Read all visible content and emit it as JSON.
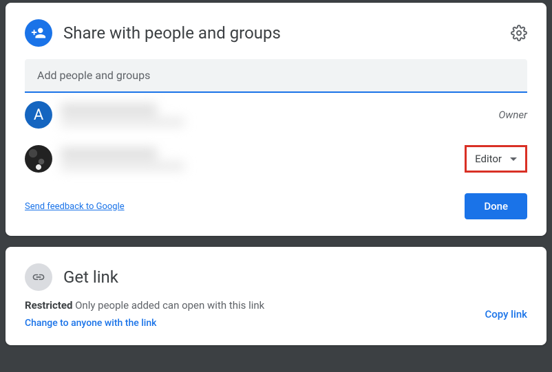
{
  "share": {
    "title": "Share with people and groups",
    "input_placeholder": "Add people and groups",
    "owner_label": "Owner",
    "role_label": "Editor",
    "feedback": "Send feedback to Google",
    "done": "Done",
    "avatar_letter": "A"
  },
  "getlink": {
    "title": "Get link",
    "restricted_bold": "Restricted",
    "restricted_text": " Only people added can open with this link",
    "change": "Change to anyone with the link",
    "copy": "Copy link"
  }
}
